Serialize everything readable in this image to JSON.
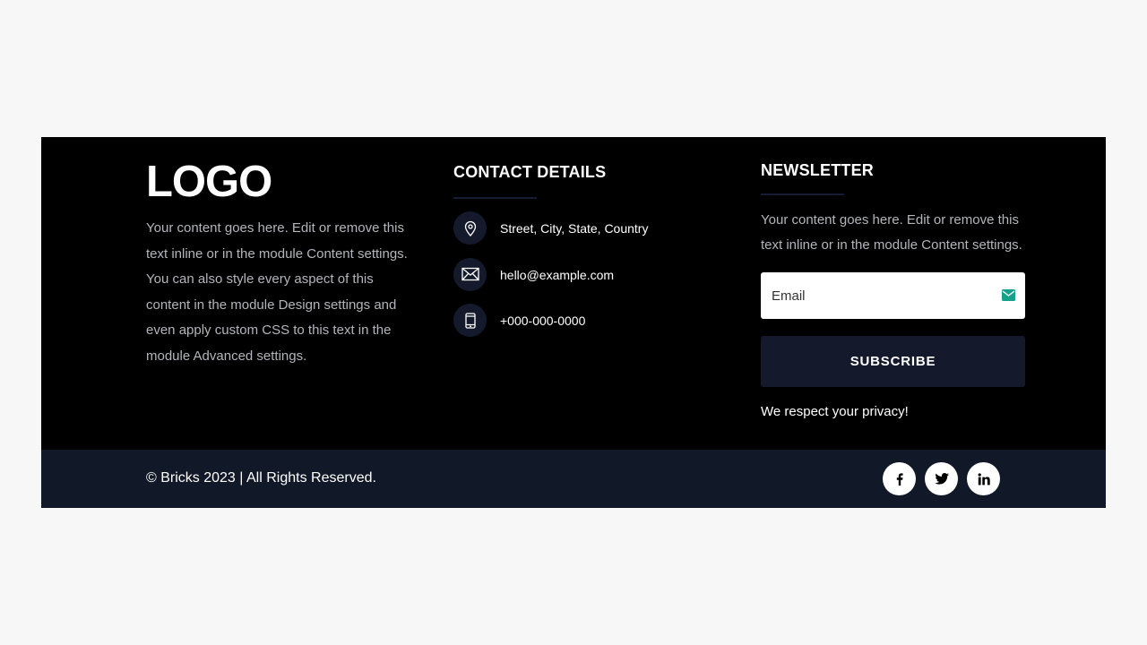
{
  "colors": {
    "footer_bg": "#000000",
    "bottom_bar_bg": "#111827",
    "accent_dark": "#141a2c",
    "email_icon": "#16a18a",
    "page_bg": "#f7f7f8"
  },
  "about": {
    "logo": "LOGO",
    "text": "Your content goes here. Edit or remove this text inline or in the module Content settings. You can also style every aspect of this content in the module Design settings and even apply custom CSS to this text in the module Advanced settings."
  },
  "contact": {
    "heading": "CONTACT DETAILS",
    "items": [
      {
        "icon": "map-pin-icon",
        "text": "Street, City, State, Country"
      },
      {
        "icon": "envelope-icon",
        "text": "hello@example.com"
      },
      {
        "icon": "phone-icon",
        "text": "+000-000-0000"
      }
    ]
  },
  "newsletter": {
    "heading": "NEWSLETTER",
    "text": "Your content goes here. Edit or remove this text inline or in the module Content settings.",
    "email_placeholder": "Email",
    "email_icon": "mail-icon",
    "subscribe_label": "SUBSCRIBE",
    "privacy_text": "We respect your privacy!"
  },
  "bottom_bar": {
    "copyright": "© Bricks 2023 | All Rights Reserved.",
    "socials": [
      {
        "icon": "facebook-icon",
        "label": "f"
      },
      {
        "icon": "twitter-icon",
        "label": "t"
      },
      {
        "icon": "linkedin-icon",
        "label": "in"
      }
    ]
  }
}
